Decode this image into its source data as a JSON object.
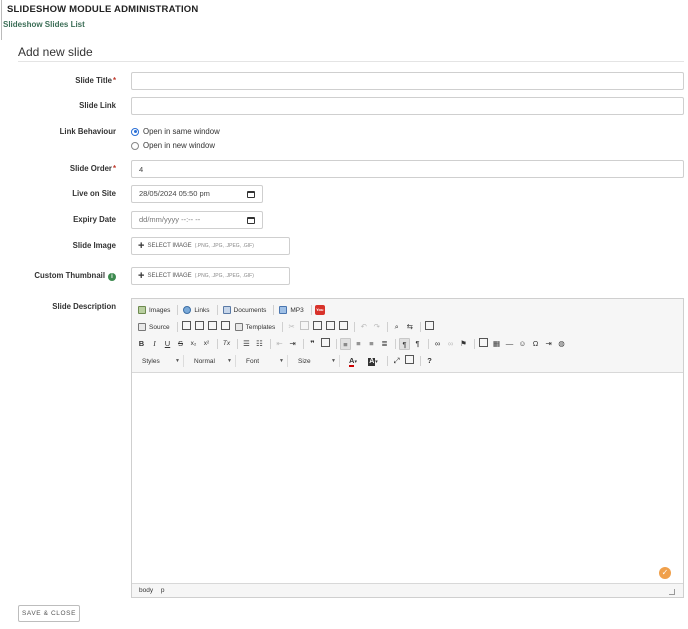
{
  "header": {
    "title": "SLIDESHOW MODULE ADMINISTRATION",
    "list_link": "Slideshow Slides List"
  },
  "section": {
    "title": "Add new slide"
  },
  "form": {
    "slide_title": {
      "label": "Slide Title",
      "required": "*",
      "value": ""
    },
    "slide_link": {
      "label": "Slide Link",
      "value": ""
    },
    "link_behaviour": {
      "label": "Link Behaviour",
      "options": [
        "Open in same window",
        "Open in new window"
      ],
      "selected": "Open in same window"
    },
    "slide_order": {
      "label": "Slide Order",
      "required": "*",
      "value": "4"
    },
    "live_on_site": {
      "label": "Live on Site",
      "value": "28/05/2024 05:50 pm"
    },
    "expiry_date": {
      "label": "Expiry Date",
      "placeholder": "dd/mm/yyyy --:-- --"
    },
    "slide_image": {
      "label": "Slide Image",
      "button": "SELECT IMAGE",
      "types": "(.PNG, .JPG, .JPEG, .GIF)"
    },
    "custom_thumbnail": {
      "label": "Custom Thumbnail",
      "info_icon": "info-icon",
      "button": "SELECT IMAGE",
      "types": "(.PNG, .JPG, .JPEG, .GIF)"
    },
    "slide_description": {
      "label": "Slide Description"
    }
  },
  "editor": {
    "row1": {
      "images": "Images",
      "links": "Links",
      "documents": "Documents",
      "mp3": "MP3",
      "youtube": "You"
    },
    "row2": {
      "source": "Source",
      "templates": "Templates"
    },
    "glyphs": {
      "bold": "B",
      "italic": "I",
      "underline": "U",
      "strike": "S",
      "subscript": "x₂",
      "superscript": "x²",
      "remove_format": "Tx",
      "blockquote": "❞",
      "special_char": "Ω",
      "help": "?"
    },
    "combos": {
      "styles": "Styles",
      "format": "Normal",
      "font": "Font",
      "size": "Size"
    },
    "status_path": [
      "body",
      "p"
    ]
  },
  "footer": {
    "save_close": "SAVE & CLOSE"
  },
  "colors": {
    "accent_green": "#3c6e57",
    "required_red": "#c0392b",
    "badge_orange": "#f0a04b",
    "youtube_red": "#d8322a"
  }
}
